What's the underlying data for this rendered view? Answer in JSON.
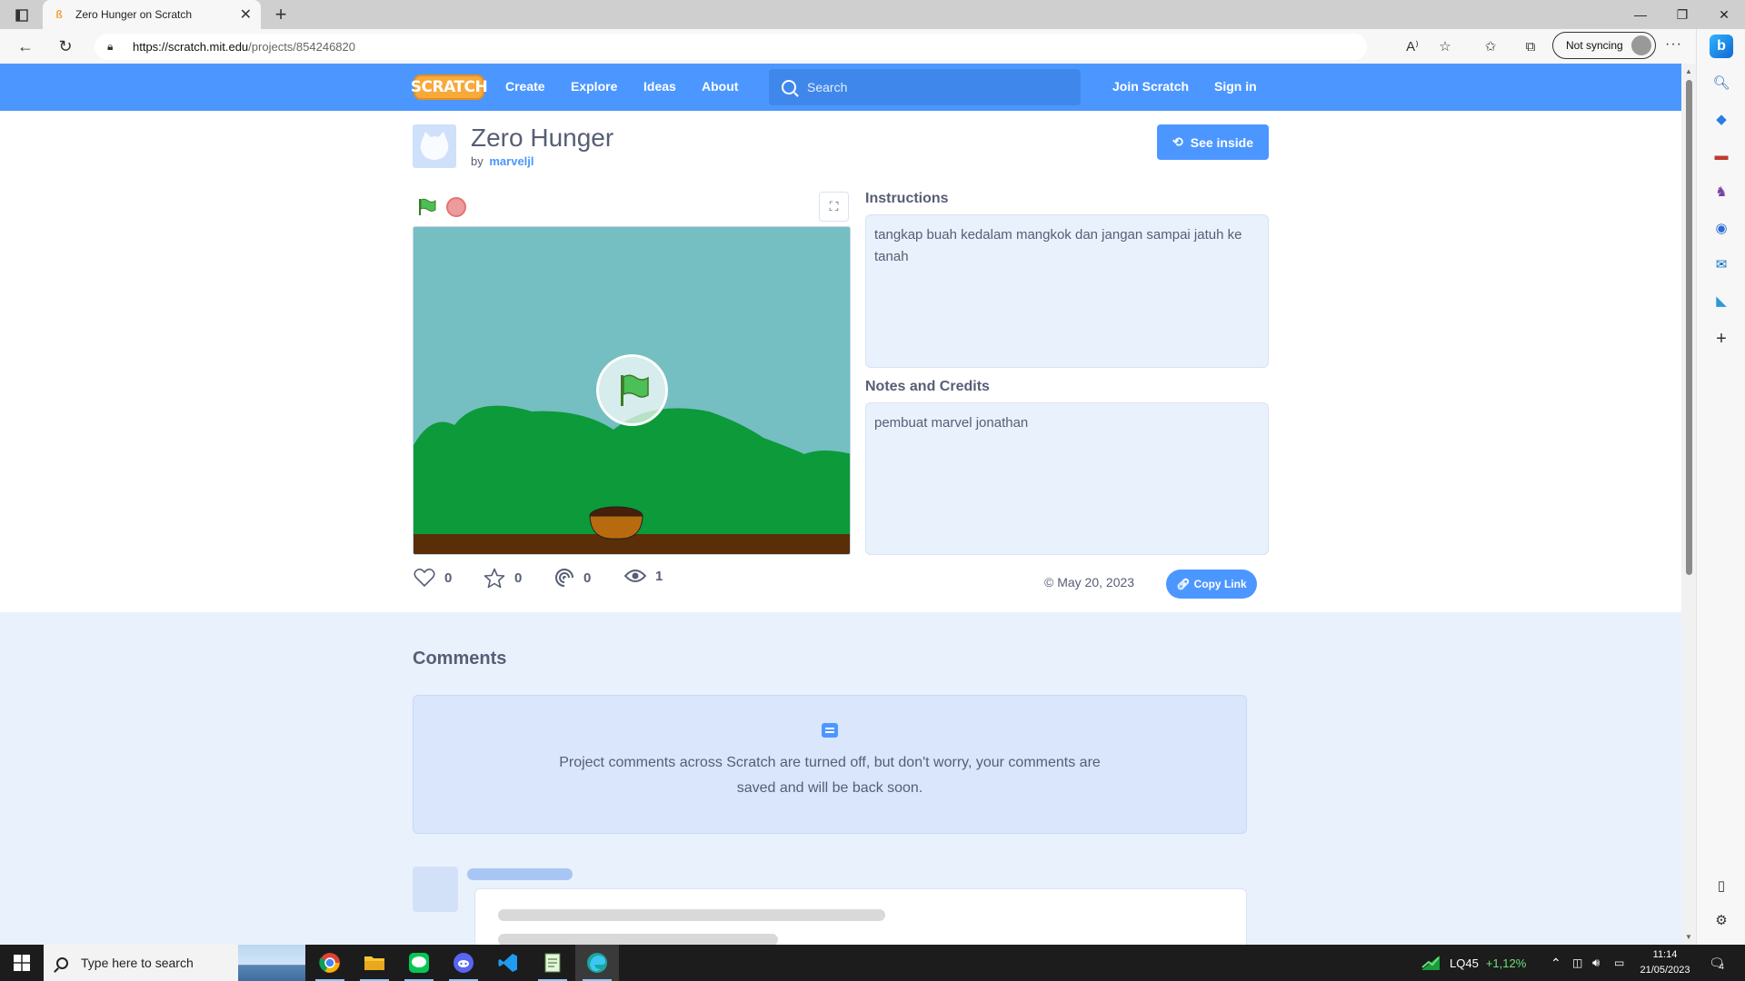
{
  "browser": {
    "tab_title": "Zero Hunger on Scratch",
    "url_host": "https://scratch.mit.edu",
    "url_path": "/projects/854246820",
    "sync_label": "Not syncing"
  },
  "nav": {
    "logo": "SCRATCH",
    "links": [
      "Create",
      "Explore",
      "Ideas",
      "About"
    ],
    "search_placeholder": "Search",
    "join": "Join Scratch",
    "signin": "Sign in"
  },
  "project": {
    "title": "Zero Hunger",
    "by_label": "by",
    "author": "marveljl",
    "see_inside": "See inside",
    "instructions_heading": "Instructions",
    "instructions": "tangkap buah kedalam mangkok dan jangan sampai jatuh ke tanah",
    "notes_heading": "Notes and Credits",
    "notes": "pembuat marvel jonathan",
    "stats": {
      "loves": "0",
      "favorites": "0",
      "remixes": "0",
      "views": "1"
    },
    "date": "May 20, 2023",
    "copy_link": "Copy Link"
  },
  "comments": {
    "heading": "Comments",
    "notice": "Project comments across Scratch are turned off, but don't worry, your comments are saved and will be back soon."
  },
  "taskbar": {
    "search_placeholder": "Type here to search",
    "stock_name": "LQ45",
    "stock_change": "+1,12%",
    "time": "11:14",
    "date": "21/05/2023",
    "notif_count": "4"
  },
  "colors": {
    "scratch_blue": "#4c97ff",
    "stage_sky": "#75bec2",
    "bush_green": "#0c9a3a",
    "ground": "#5a2e06"
  }
}
